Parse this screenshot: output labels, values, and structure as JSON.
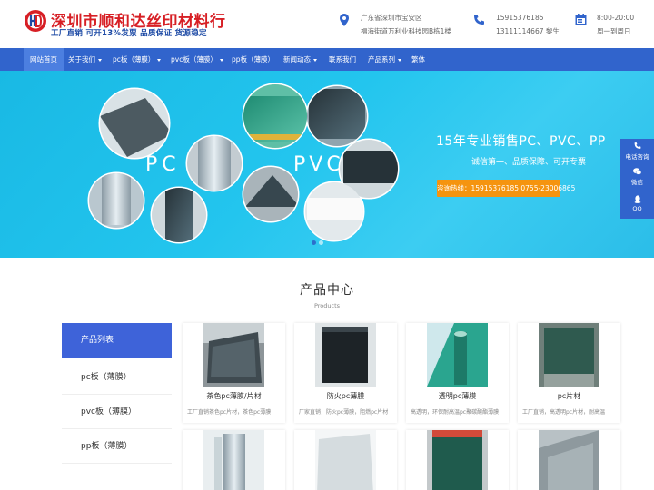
{
  "header": {
    "company_name": "深圳市顺和达丝印材料行",
    "slogan": "工厂直销  可开13%发票  品质保证  货源稳定",
    "address_line1": "广东省深圳市宝安区",
    "address_line2": "福海街道万利业科技园B栋1楼",
    "phone_line1": "15915376185",
    "phone_line2": "13111114667 黎生",
    "hours_line1": "8:00-20:00",
    "hours_line2": "周一到周日",
    "logo_letters": "HD"
  },
  "nav": {
    "items": [
      {
        "label": "网站首页"
      },
      {
        "label": "关于我们"
      },
      {
        "label": "pc板（薄膜）"
      },
      {
        "label": "pvc板（薄膜）"
      },
      {
        "label": "pp板（薄膜）"
      },
      {
        "label": "新闻动态"
      },
      {
        "label": "联系我们"
      },
      {
        "label": "产品系列"
      },
      {
        "label": "繁体"
      }
    ]
  },
  "banner": {
    "title": "15年专业销售PC、PVC、PP",
    "subtitle": "诚信第一、品质保障、可开专票",
    "hotline": "咨询热线：15915376185 0755-23006865",
    "label_pc": "PC",
    "label_pvc": "PVC"
  },
  "float": {
    "items": [
      {
        "label": "电话咨询",
        "icon": "phone-icon"
      },
      {
        "label": "微信",
        "icon": "wechat-icon"
      },
      {
        "label": "QQ",
        "icon": "qq-icon"
      }
    ]
  },
  "products": {
    "title": "产品中心",
    "subtitle": "Products",
    "category_head": "产品列表",
    "categories": [
      {
        "label": "pc板（薄膜）"
      },
      {
        "label": "pvc板（薄膜）"
      },
      {
        "label": "pp板（薄膜）"
      }
    ],
    "cards": [
      {
        "name": "茶色pc薄膜/片材",
        "desc": "工厂直销茶色pc片材，茶色pc薄膜"
      },
      {
        "name": "防火pc薄膜",
        "desc": "厂家直销，防火pc薄膜，阻燃pc片材"
      },
      {
        "name": "透明pc薄膜",
        "desc": "高透明，环保耐高温pc聚碳酸酯薄膜"
      },
      {
        "name": "pc片材",
        "desc": "工厂直销，高透明pc片材，耐高温"
      }
    ]
  },
  "colors": {
    "brand_blue": "#3164cc",
    "brand_red": "#d71f25",
    "accent_orange": "#f5940f",
    "banner_cyan": "#23c5ee"
  }
}
